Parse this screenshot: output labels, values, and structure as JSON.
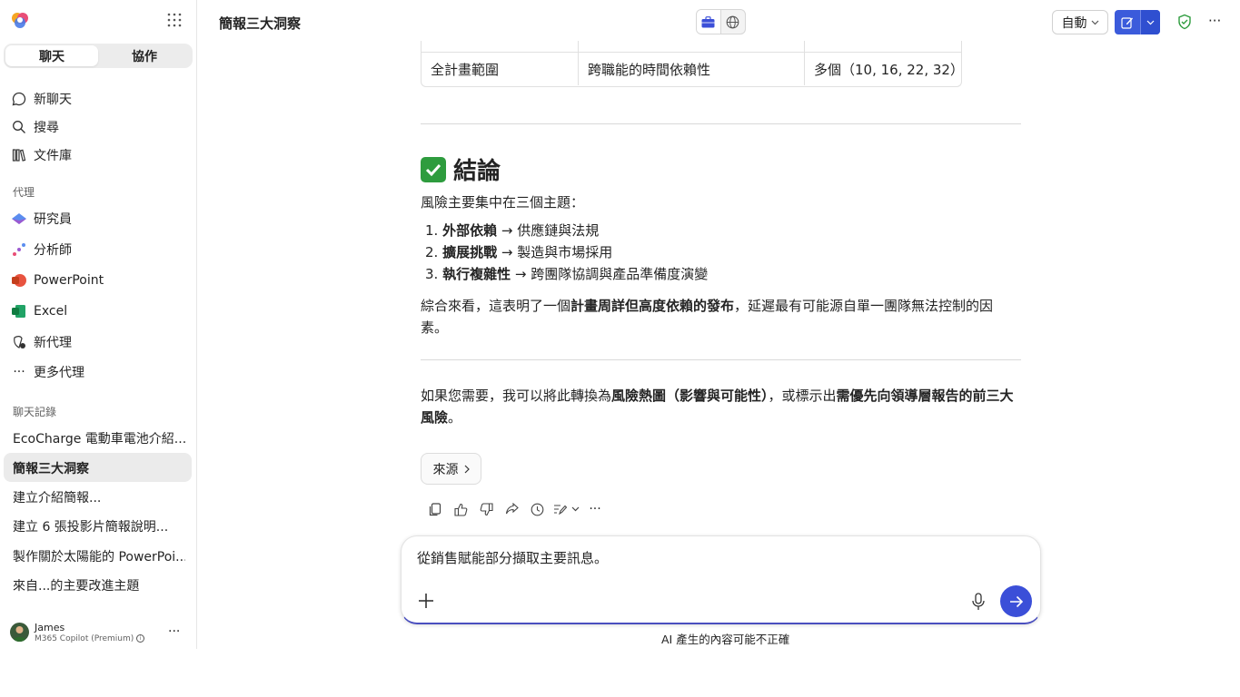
{
  "sidebar": {
    "tabs": [
      {
        "label": "聊天",
        "active": true
      },
      {
        "label": "協作",
        "active": false
      }
    ],
    "nav": [
      {
        "label": "新聊天",
        "icon": "chat-bubble-icon"
      },
      {
        "label": "搜尋",
        "icon": "search-icon"
      },
      {
        "label": "文件庫",
        "icon": "library-icon"
      }
    ],
    "agents_label": "代理",
    "agents": [
      {
        "label": "研究員",
        "icon": "researcher-icon"
      },
      {
        "label": "分析師",
        "icon": "analyst-icon"
      },
      {
        "label": "PowerPoint",
        "icon": "powerpoint-icon"
      },
      {
        "label": "Excel",
        "icon": "excel-icon"
      },
      {
        "label": "新代理",
        "icon": "new-agent-icon"
      },
      {
        "label": "更多代理",
        "icon": "more-icon"
      }
    ],
    "history_label": "聊天記錄",
    "history": [
      "EcoCharge 電動車電池介紹...",
      "簡報三大洞察",
      "建立介紹簡報...",
      "建立 6 張投影片簡報說明...",
      "製作關於太陽能的 PowerPoi...",
      "來自...的主要改進主題"
    ],
    "user": {
      "name": "James",
      "plan": "M365 Copilot (Premium)"
    }
  },
  "header": {
    "title": "簡報三大洞察",
    "mode_button": "自動",
    "colors": {
      "accent": "#3b5bdb",
      "shield": "#2e9c3e"
    }
  },
  "content": {
    "table_row": [
      "全計畫範圍",
      "跨職能的時間依賴性",
      "多個（10, 16, 22, 32）"
    ],
    "conclusion_heading": "結論",
    "intro": "風險主要集中在三個主題：",
    "list": [
      {
        "num": "1.",
        "bold": "外部依賴",
        "rest": " → 供應鏈與法規"
      },
      {
        "num": "2.",
        "bold": "擴展挑戰",
        "rest": " → 製造與市場採用"
      },
      {
        "num": "3.",
        "bold": "執行複雜性",
        "rest": " → 跨團隊協調與產品準備度演變"
      }
    ],
    "summary": {
      "pre": "綜合來看，這表明了一個",
      "bold": "計畫周詳但高度依賴的發布",
      "post": "，延遲最有可能源自單一團隊無法控制的因素。"
    },
    "offer": {
      "pre": "如果您需要，我可以將此轉換為",
      "bold1": "風險熱圖（影響與可能性）",
      "mid": "，或標示出",
      "bold2": "需優先向領導層報告的前三大風險",
      "post": "。"
    },
    "sources_button": "來源"
  },
  "composer": {
    "text": "從銷售賦能部分擷取主要訊息。",
    "disclaimer": "AI 產生的內容可能不正確"
  }
}
